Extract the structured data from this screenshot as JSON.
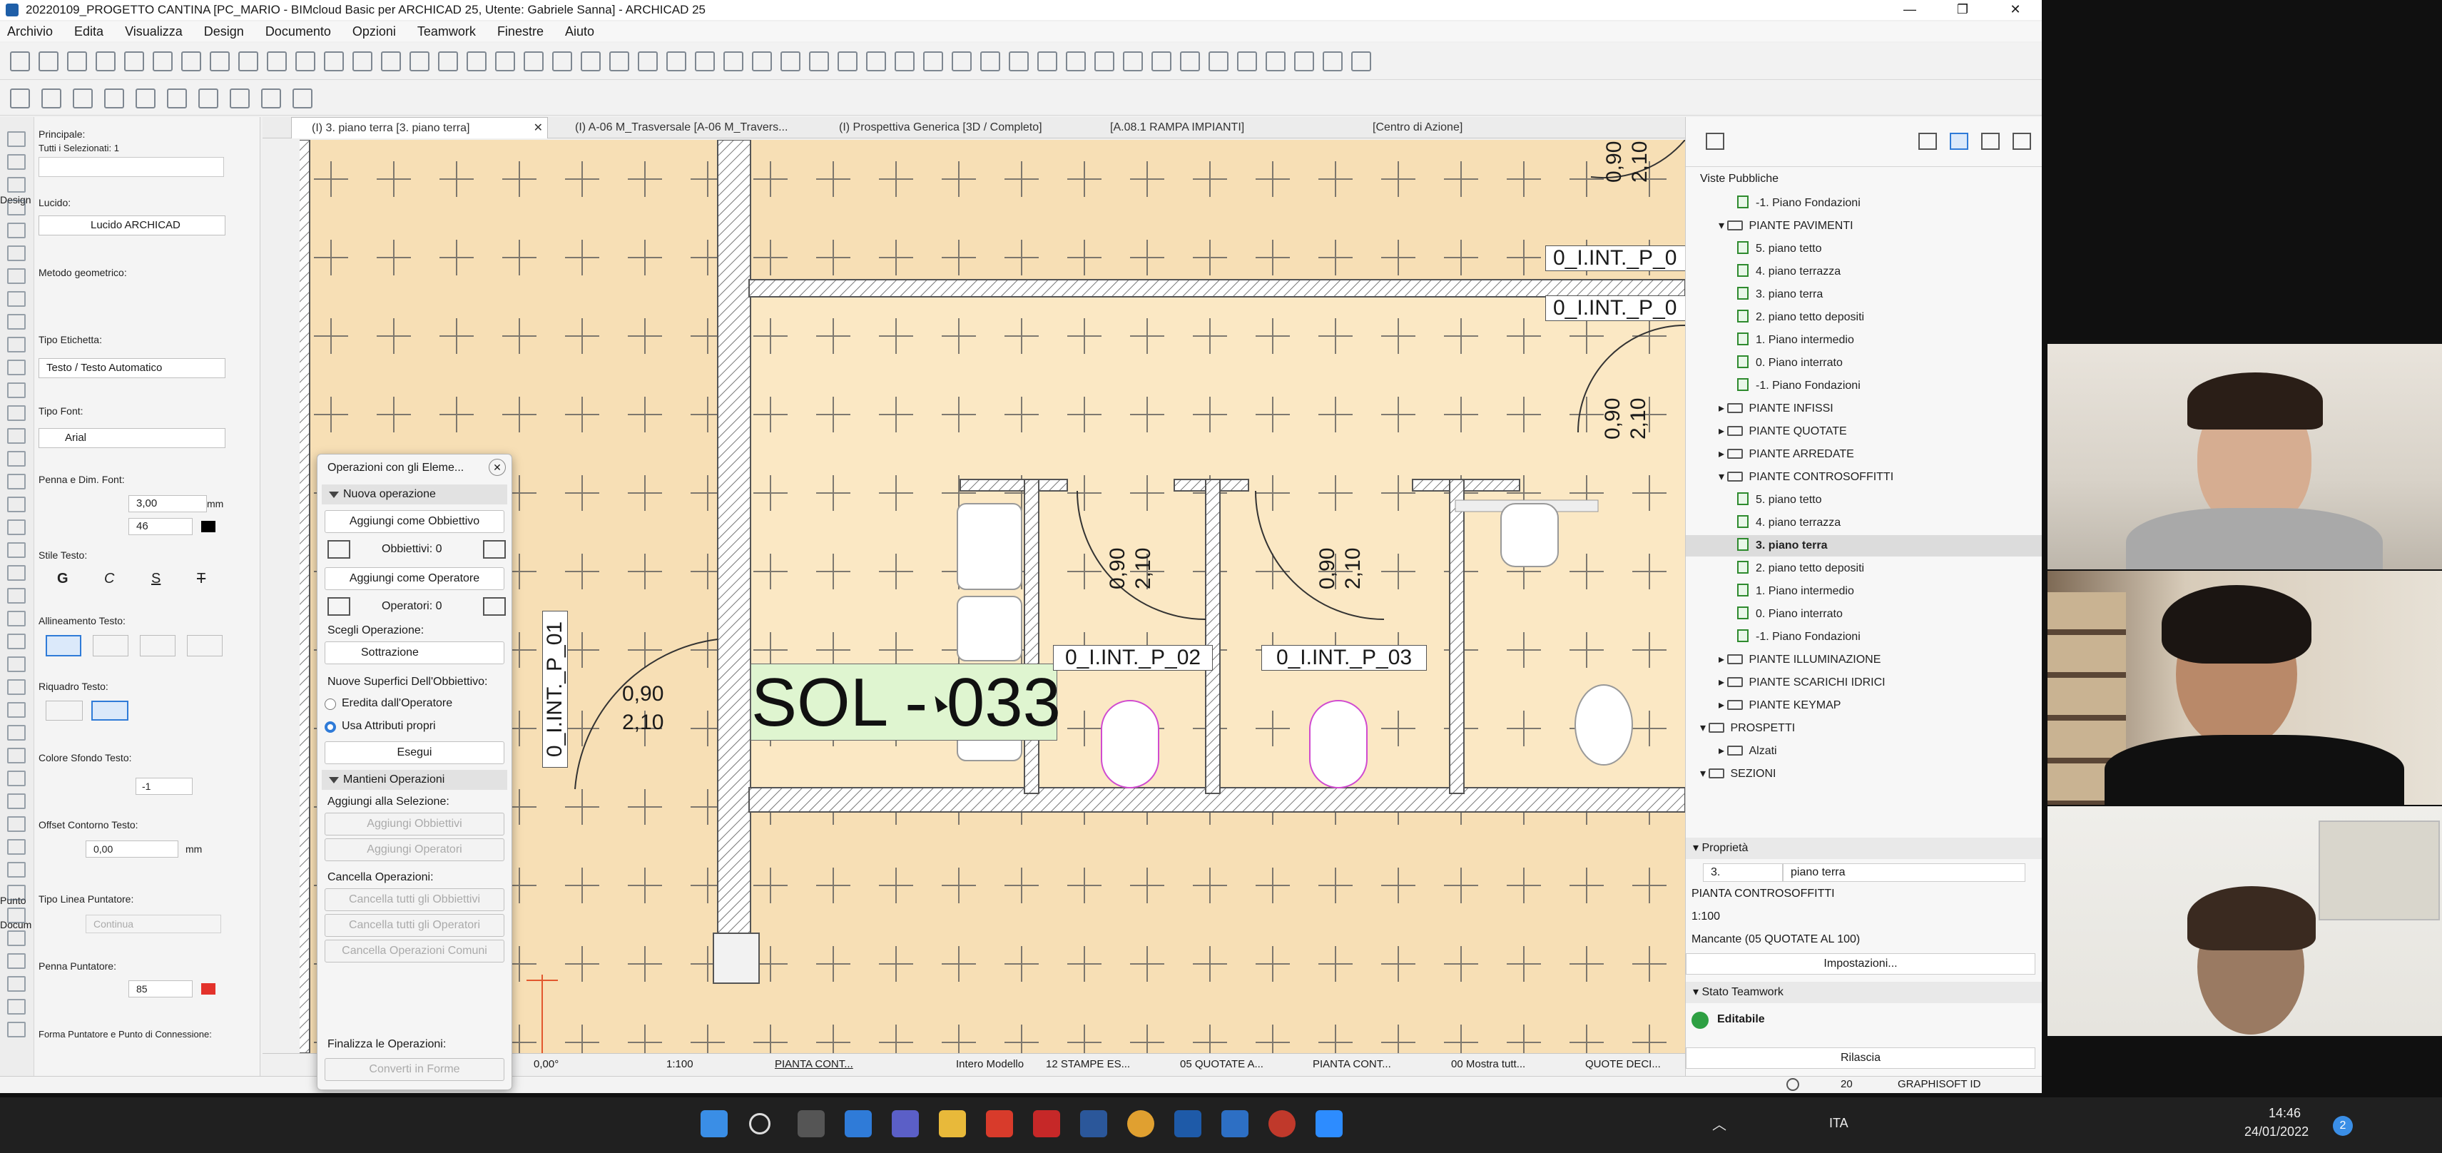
{
  "window": {
    "title": "20220109_PROGETTO CANTINA [PC_MARIO - BIMcloud Basic per ARCHICAD 25, Utente: Gabriele Sanna] - ARCHICAD 25",
    "minimize": "—",
    "restore": "❐",
    "close": "✕"
  },
  "menu": [
    "Archivio",
    "Edita",
    "Visualizza",
    "Design",
    "Documento",
    "Opzioni",
    "Teamwork",
    "Finestre",
    "Aiuto"
  ],
  "tabs": [
    {
      "label": "(I) 3. piano terra [3. piano terra]",
      "close": "✕"
    },
    {
      "label": "(I) A-06 M_Trasversale [A-06 M_Travers..."
    },
    {
      "label": "(I) Prospettiva Generica [3D / Completo]"
    },
    {
      "label": "[A.08.1 RAMPA IMPIANTI]"
    },
    {
      "label": "[Centro di Azione]"
    }
  ],
  "left_panel": {
    "principale": "Principale:",
    "selected": "Tutti i Selezionati: 1",
    "lucido_label": "Lucido:",
    "lucido_value": "Lucido ARCHICAD",
    "metodo": "Metodo geometrico:",
    "tipo_etichetta": "Tipo Etichetta:",
    "tipo_etichetta_value": "Testo / Testo Automatico",
    "tipo_font": "Tipo Font:",
    "font_value": "Arial",
    "penna_dim": "Penna e Dim. Font:",
    "size_value": "3,00",
    "size_unit": "mm",
    "pen_value": "46",
    "stile": "Stile Testo:",
    "styles": [
      "G",
      "C",
      "S",
      "T"
    ],
    "allineamento": "Allineamento Testo:",
    "riquadro": "Riquadro Testo:",
    "colore_sfondo": "Colore Sfondo Testo:",
    "sfondo_pen": "-1",
    "offset": "Offset Contorno Testo:",
    "offset_value": "0,00",
    "offset_unit": "mm",
    "tipo_linea": "Tipo Linea Puntatore:",
    "linea_value": "Continua",
    "penna_punt": "Penna Puntatore:",
    "penna_punt_value": "85",
    "forma": "Forma Puntatore e Punto di Connessione:",
    "tool_labels": [
      "Design",
      "Punto",
      "Docum"
    ]
  },
  "dialog": {
    "title": "Operazioni con gli Eleme...",
    "close": "✕",
    "nuova": "Nuova operazione",
    "add_target": "Aggiungi come Obbiettivo",
    "targets": "Obbiettivi: 0",
    "add_operator": "Aggiungi come Operatore",
    "operators": "Operatori: 0",
    "scegli": "Scegli Operazione:",
    "operation": "Sottrazione",
    "nuove_sup": "Nuove Superfici Dell'Obbiettivo:",
    "eredita": "Eredita dall'Operatore",
    "usa": "Usa Attributi propri",
    "esegui": "Esegui",
    "mantieni": "Mantieni Operazioni",
    "aggiungi_sel": "Aggiungi alla Selezione:",
    "agg_obb": "Aggiungi Obbiettivi",
    "agg_op": "Aggiungi Operatori",
    "cancella": "Cancella Operazioni:",
    "canc_obb": "Cancella tutti gli Obbiettivi",
    "canc_op": "Cancella tutti gli Operatori",
    "canc_com": "Cancella Operazioni Comuni",
    "finalizza": "Finalizza le Operazioni:",
    "converti": "Converti in Forme"
  },
  "drawing": {
    "main_label": "SOL - 033",
    "labels": [
      "0_I.INT._P_02",
      "0_I.INT._P_03",
      "0_I.INT._P_0",
      "0_I.INT._P_0",
      "0_I.INT._P_01"
    ],
    "door_w": "0,90",
    "door_h": "2,10"
  },
  "right_panel": {
    "header": "Viste Pubbliche",
    "tree": [
      {
        "label": "-1. Piano Fondazioni",
        "level": 2,
        "type": "page"
      },
      {
        "label": "PIANTE PAVIMENTI",
        "level": 1,
        "type": "folder",
        "open": true
      },
      {
        "label": "5. piano tetto",
        "level": 2,
        "type": "page"
      },
      {
        "label": "4. piano terrazza",
        "level": 2,
        "type": "page"
      },
      {
        "label": "3. piano terra",
        "level": 2,
        "type": "page"
      },
      {
        "label": "2. piano tetto depositi",
        "level": 2,
        "type": "page"
      },
      {
        "label": "1. Piano intermedio",
        "level": 2,
        "type": "page"
      },
      {
        "label": "0. Piano interrato",
        "level": 2,
        "type": "page"
      },
      {
        "label": "-1. Piano Fondazioni",
        "level": 2,
        "type": "page"
      },
      {
        "label": "PIANTE INFISSI",
        "level": 1,
        "type": "folder"
      },
      {
        "label": "PIANTE QUOTATE",
        "level": 1,
        "type": "folder"
      },
      {
        "label": "PIANTE ARREDATE",
        "level": 1,
        "type": "folder"
      },
      {
        "label": "PIANTE CONTROSOFFITTI",
        "level": 1,
        "type": "folder",
        "open": true
      },
      {
        "label": "5. piano tetto",
        "level": 2,
        "type": "page"
      },
      {
        "label": "4. piano terrazza",
        "level": 2,
        "type": "page"
      },
      {
        "label": "3. piano terra",
        "level": 2,
        "type": "page",
        "selected": true
      },
      {
        "label": "2. piano tetto depositi",
        "level": 2,
        "type": "page"
      },
      {
        "label": "1. Piano intermedio",
        "level": 2,
        "type": "page"
      },
      {
        "label": "0. Piano interrato",
        "level": 2,
        "type": "page"
      },
      {
        "label": "-1. Piano Fondazioni",
        "level": 2,
        "type": "page"
      },
      {
        "label": "PIANTE ILLUMINAZIONE",
        "level": 1,
        "type": "folder"
      },
      {
        "label": "PIANTE SCARICHI IDRICI",
        "level": 1,
        "type": "folder"
      },
      {
        "label": "PIANTE KEYMAP",
        "level": 1,
        "type": "folder"
      },
      {
        "label": "PROSPETTI",
        "level": 0,
        "type": "folder",
        "open": true
      },
      {
        "label": "Alzati",
        "level": 1,
        "type": "folder"
      },
      {
        "label": "SEZIONI",
        "level": 0,
        "type": "folder",
        "open": true
      }
    ],
    "proprieta": "Proprietà",
    "prop_num": "3.",
    "prop_name": "piano terra",
    "prop_set": "PIANTA CONTROSOFFITTI",
    "prop_scale": "1:100",
    "prop_missing": "Mancante (05 QUOTATE AL 100)",
    "impostazioni": "Impostazioni...",
    "stato_teamwork": "Stato Teamwork",
    "editabile": "Editabile",
    "rilascia": "Rilascia"
  },
  "statusbar": {
    "angle": "0,00°",
    "scale": "1:100",
    "set": "PIANTA CONT...",
    "model": "Intero Modello",
    "print": "12 STAMPE ES...",
    "dims": "05 QUOTATE A...",
    "plan": "PIANTA CONT...",
    "show": "00 Mostra tutt...",
    "quote": "QUOTE DECI..."
  },
  "bottom": {
    "count": "20",
    "brand": "GRAPHISOFT ID"
  },
  "taskbar": {
    "lang": "ITA",
    "time": "14:46",
    "date": "24/01/2022",
    "notif": "2"
  },
  "colors": {
    "floor": "#f7dfb5",
    "room_floor": "#fbe8c4",
    "wall": "#7e7e7e",
    "label_highlight": "#dff5d0",
    "accent": "#2f7bd8"
  }
}
